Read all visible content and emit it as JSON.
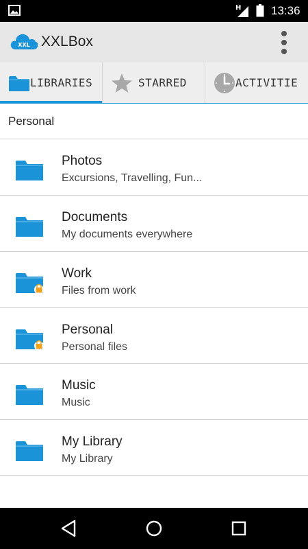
{
  "status_bar": {
    "time": "13:36",
    "network": "H",
    "icons": [
      "image-notification-icon",
      "signal-icon",
      "battery-icon"
    ]
  },
  "app_bar": {
    "logo_text": "XXL",
    "title": "XXLBox",
    "menu_icon": "overflow-menu-icon"
  },
  "tabs": [
    {
      "label": "LIBRARIES",
      "icon": "folder-icon",
      "active": true
    },
    {
      "label": "STARRED",
      "icon": "star-icon",
      "active": false
    },
    {
      "label": "ACTIVITIE",
      "icon": "clock-icon",
      "active": false
    }
  ],
  "section_label": "Personal",
  "libraries": [
    {
      "name": "Photos",
      "description": "Excursions, Travelling, Fun...",
      "locked": false
    },
    {
      "name": "Documents",
      "description": "My documents everywhere",
      "locked": false
    },
    {
      "name": "Work",
      "description": "Files from work",
      "locked": true
    },
    {
      "name": "Personal",
      "description": "Personal files",
      "locked": true
    },
    {
      "name": "Music",
      "description": "Music",
      "locked": false
    },
    {
      "name": "My Library",
      "description": "My Library",
      "locked": false
    }
  ],
  "nav_bar": [
    "back-icon",
    "home-icon",
    "recents-icon"
  ],
  "colors": {
    "accent": "#1a93d9",
    "folder": "#1a93d9",
    "lock": "#f2a31c"
  }
}
